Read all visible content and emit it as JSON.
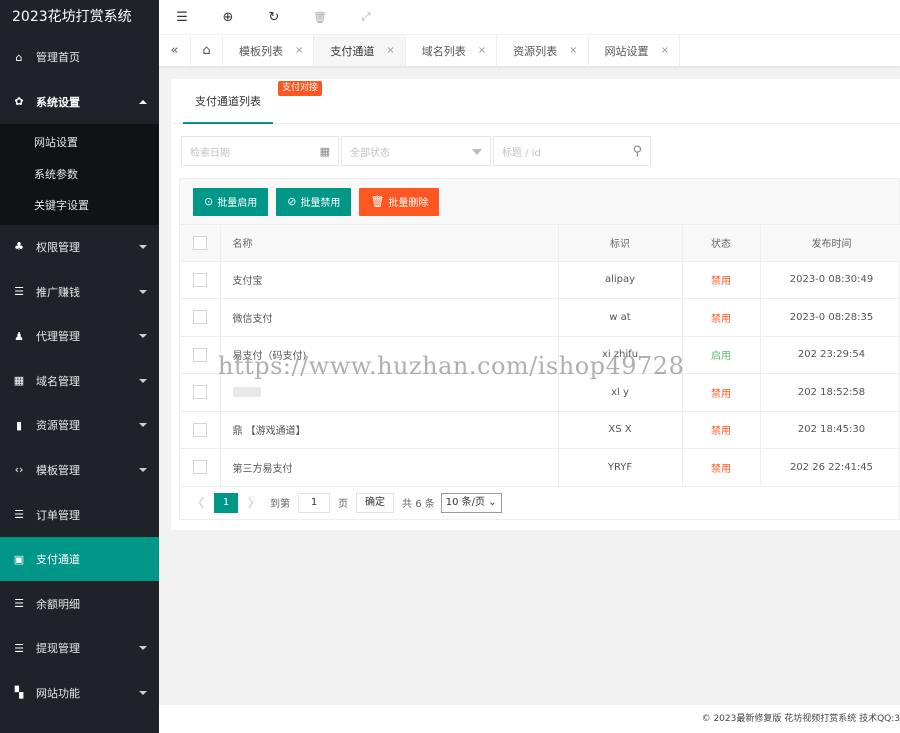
{
  "app": {
    "title": "2023花坊打赏系统"
  },
  "sidebar": {
    "items": [
      {
        "label": "管理首页",
        "icon": "home-icon",
        "glyph": "⌂",
        "has_arrow": false
      },
      {
        "label": "系统设置",
        "icon": "gear-icon",
        "glyph": "✿",
        "has_arrow": true,
        "open": true,
        "children": [
          "网站设置",
          "系统参数",
          "关键字设置"
        ]
      },
      {
        "label": "权限管理",
        "icon": "users-icon",
        "glyph": "♣",
        "has_arrow": true
      },
      {
        "label": "推广赚钱",
        "icon": "list-icon",
        "glyph": "☰",
        "has_arrow": true
      },
      {
        "label": "代理管理",
        "icon": "user-icon",
        "glyph": "♟",
        "has_arrow": true
      },
      {
        "label": "域名管理",
        "icon": "app-icon",
        "glyph": "▦",
        "has_arrow": true
      },
      {
        "label": "资源管理",
        "icon": "bookmark-icon",
        "glyph": "▮",
        "has_arrow": true
      },
      {
        "label": "模板管理",
        "icon": "code-icon",
        "glyph": "‹›",
        "has_arrow": true
      },
      {
        "label": "订单管理",
        "icon": "list-icon",
        "glyph": "☰",
        "has_arrow": false
      },
      {
        "label": "支付通道",
        "icon": "grid-icon",
        "glyph": "▣",
        "has_arrow": false,
        "active": true
      },
      {
        "label": "余额明细",
        "icon": "list-icon",
        "glyph": "☰",
        "has_arrow": false
      },
      {
        "label": "提现管理",
        "icon": "list-icon",
        "glyph": "☰",
        "has_arrow": true
      },
      {
        "label": "网站功能",
        "icon": "apps-icon",
        "glyph": "▚",
        "has_arrow": true
      }
    ]
  },
  "topbar": {
    "icons": [
      {
        "name": "menu-fold-icon",
        "glyph": "☰"
      },
      {
        "name": "globe-icon",
        "glyph": "⊕"
      },
      {
        "name": "refresh-icon",
        "glyph": "↻"
      },
      {
        "name": "trash-icon",
        "glyph": "🗑"
      },
      {
        "name": "fullscreen-icon",
        "glyph": "⤢"
      }
    ]
  },
  "tabs": {
    "items": [
      {
        "label": "模板列表",
        "active": false
      },
      {
        "label": "支付通道",
        "active": true
      },
      {
        "label": "域名列表",
        "active": false
      },
      {
        "label": "资源列表",
        "active": false
      },
      {
        "label": "网站设置",
        "active": false
      }
    ],
    "close_glyph": "×"
  },
  "card": {
    "tab_label": "支付通道列表",
    "badge": "支付对接"
  },
  "filters": {
    "date_placeholder": "检索日期",
    "status_placeholder": "全部状态",
    "search_placeholder": "标题 / id"
  },
  "toolbar": {
    "enable_label": "批量启用",
    "disable_label": "批量禁用",
    "delete_label": "批量删除"
  },
  "table": {
    "headers": [
      "名称",
      "标识",
      "状态",
      "发布时间"
    ],
    "rows": [
      {
        "name": "支付宝",
        "code": "alipay",
        "status": "禁用",
        "status_type": "off",
        "time": "2023-0      08:30:49"
      },
      {
        "name": "微信支付",
        "code": "w      at",
        "status": "禁用",
        "status_type": "off",
        "time": "2023-0      08:28:35"
      },
      {
        "name": "易支付（码支付)",
        "code": "xi        zhifu",
        "status": "启用",
        "status_type": "on",
        "time": "202        23:29:54"
      },
      {
        "name": "",
        "code": "xl      y",
        "status": "禁用",
        "status_type": "off",
        "time": "202        18:52:58"
      },
      {
        "name": "鼎        【游戏通道】",
        "code": "XS      X",
        "status": "禁用",
        "status_type": "off",
        "time": "202        18:45:30"
      },
      {
        "name": "第三方易支付",
        "code": "YRYF",
        "status": "禁用",
        "status_type": "off",
        "time": "202      26 22:41:45"
      }
    ]
  },
  "pager": {
    "prev": "〈",
    "current": "1",
    "next": "〉",
    "goto_label": "到第",
    "goto_value": "1",
    "page_unit": "页",
    "confirm_label": "确定",
    "total_label": "共 6 条",
    "page_size": "10 条/页 ⌄"
  },
  "watermark": "https://www.huzhan.com/ishop49728",
  "footer": {
    "text": "© 2023最新修复版 花坊视频打赏系统 技术QQ:3"
  },
  "colors": {
    "sidebar_bg": "#20222a",
    "accent": "#009688",
    "danger": "#ff5722",
    "enabled": "#5fb878"
  }
}
